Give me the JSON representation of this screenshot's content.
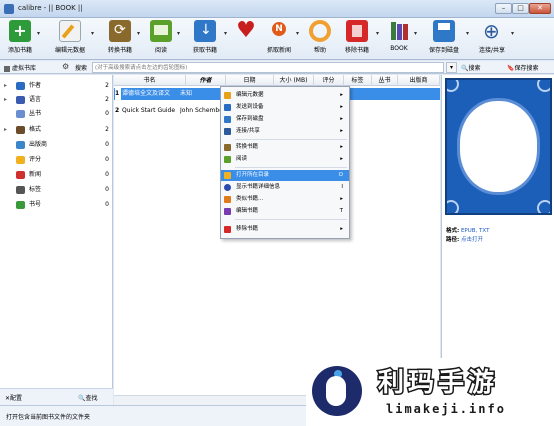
{
  "window": {
    "title": "calibre - || BOOK ||",
    "min": "–",
    "max": "□",
    "close": "✕"
  },
  "toolbar": [
    {
      "label": "添加书籍",
      "icon": "add-book-icon"
    },
    {
      "label": "编辑元数据",
      "icon": "edit-metadata-icon"
    },
    {
      "label": "转换书籍",
      "icon": "convert-icon"
    },
    {
      "label": "阅读",
      "icon": "read-icon"
    },
    {
      "label": "获取书籍",
      "icon": "fetch-icon"
    },
    {
      "label": "",
      "icon": "heart-icon"
    },
    {
      "label": "抓取新闻",
      "icon": "news-icon"
    },
    {
      "label": "帮助",
      "icon": "help-icon"
    },
    {
      "label": "移除书籍",
      "icon": "remove-icon"
    },
    {
      "label": "BOOK",
      "icon": "library-icon"
    },
    {
      "label": "保存到磁盘",
      "icon": "save-icon"
    },
    {
      "label": "连接/共享",
      "icon": "connect-icon"
    }
  ],
  "subbar": {
    "virtual_library": "虚拟书库",
    "search_label": "搜索",
    "search_placeholder": "(对于高级搜索请点击左边的齿轮图标)",
    "search_button": "搜索",
    "saved_search": "保存搜索"
  },
  "tag_browser": [
    {
      "label": "作者",
      "count": "2",
      "color": "#2a6bc2"
    },
    {
      "label": "语言",
      "count": "2",
      "color": "#3b5bb0"
    },
    {
      "label": "丛书",
      "count": "0",
      "color": "#6a8ed0"
    },
    {
      "label": "格式",
      "count": "2",
      "color": "#6b4b2a"
    },
    {
      "label": "出版商",
      "count": "0",
      "color": "#3a86c8"
    },
    {
      "label": "评分",
      "count": "0",
      "color": "#f0b020"
    },
    {
      "label": "新闻",
      "count": "0",
      "color": "#d03030"
    },
    {
      "label": "标签",
      "count": "0",
      "color": "#555555"
    },
    {
      "label": "书号",
      "count": "0",
      "color": "#3a9a3a"
    }
  ],
  "left_bottom": {
    "config": "配置",
    "find": "查找"
  },
  "table": {
    "headers": [
      "书名",
      "作者",
      "日期",
      "大小 (MB)",
      "评分",
      "标签",
      "丛书",
      "出版商"
    ],
    "rows": [
      {
        "num": "1",
        "title": "谭德培全文及译文",
        "author": "未知",
        "selected": true
      },
      {
        "num": "2",
        "title": "Quick Start Guide",
        "author": "John Schember",
        "selected": false
      }
    ]
  },
  "context_menu": [
    {
      "label": "编辑元数据",
      "shortcut": "▸",
      "color": "#e8a21a"
    },
    {
      "label": "发送到设备",
      "shortcut": "▸",
      "color": "#2a6bc2"
    },
    {
      "label": "保存到磁盘",
      "shortcut": "▸",
      "color": "#2f78c8"
    },
    {
      "label": "连接/共享",
      "shortcut": "▸",
      "color": "#2a5a9a"
    },
    {
      "label": "转换书籍",
      "shortcut": "▸",
      "color": "#8a6a2c"
    },
    {
      "label": "阅读",
      "shortcut": "▸",
      "color": "#5aa02a"
    },
    {
      "label": "打开所在目录",
      "shortcut": "O",
      "color": "#f0b020",
      "highlight": true
    },
    {
      "label": "显示书籍详细信息",
      "shortcut": "I",
      "color": "#2a4ab0"
    },
    {
      "label": "类似书籍...",
      "shortcut": "▸",
      "color": "#e07a1a"
    },
    {
      "label": "编辑书籍",
      "shortcut": "T",
      "color": "#7a3ab0"
    },
    {
      "label": "移除书籍",
      "shortcut": "▸",
      "color": "#d62828"
    }
  ],
  "book_info": {
    "formats_label": "格式:",
    "formats_value": "EPUB, TXT",
    "path_label": "路径:",
    "path_value": "点击打开"
  },
  "statusbar": {
    "text": "打开包含当前图书文件的文件夹"
  },
  "watermark": {
    "title": "利玛手游",
    "subtitle": "limakeji.info"
  }
}
